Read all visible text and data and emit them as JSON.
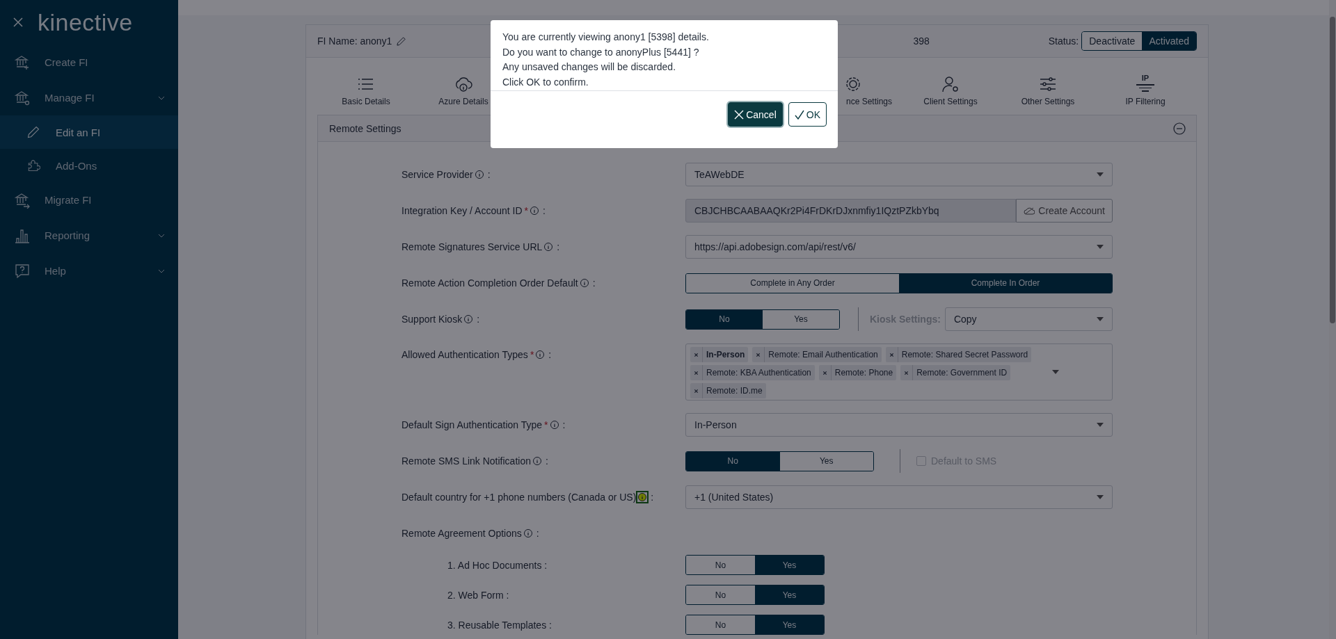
{
  "sidebar": {
    "logo": "kinective",
    "items": [
      {
        "label": "Create FI",
        "selected": false
      },
      {
        "label": "Manage FI",
        "selected": false,
        "chevron": true,
        "children": [
          {
            "label": "Edit an FI",
            "selected": true
          },
          {
            "label": "Add-Ons",
            "selected": false
          }
        ]
      },
      {
        "label": "Migrate FI",
        "selected": false
      },
      {
        "label": "Reporting",
        "selected": false,
        "chevron": true
      },
      {
        "label": "Help",
        "selected": false,
        "chevron": true
      }
    ]
  },
  "header": {
    "fi_name": "FI Name: anony1",
    "fi_id_tail": "398",
    "status_label": "Status:",
    "status_options": [
      {
        "label": "Deactivate",
        "selected": false
      },
      {
        "label": "Activated",
        "selected": true
      }
    ]
  },
  "tabs": [
    {
      "label": "Basic Details",
      "selected": false
    },
    {
      "label": "Azure Details",
      "selected": false
    },
    {
      "label": "nce Settings",
      "selected": false
    },
    {
      "label": "Client Settings",
      "selected": false
    },
    {
      "label": "Other Settings",
      "selected": false
    },
    {
      "label": "IP Filtering",
      "icon_text": "IP",
      "selected": false
    }
  ],
  "panel": {
    "title": "Remote Settings",
    "expanded": true,
    "rows": [
      {
        "kind": "select",
        "label": "Service Provider",
        "info": true,
        "colon": ":",
        "value": "TeAWebDE"
      },
      {
        "kind": "input_button",
        "label": "Integration Key / Account ID",
        "required": "*",
        "info": true,
        "colon": ":",
        "value": "CBJCHBCAABAAQKr2Pi4FrDKrDJxnmfiy1IQztPZkbYbq",
        "button": "Create Account"
      },
      {
        "kind": "select",
        "label": "Remote Signatures Service URL",
        "info": true,
        "colon": ":",
        "value": "https://api.adobesign.com/api/rest/v6/"
      },
      {
        "kind": "segmented",
        "label": "Remote Action Completion Order Default",
        "info": true,
        "colon": ":",
        "options": [
          {
            "label": "Complete in Any Order",
            "selected": false
          },
          {
            "label": "Complete In Order",
            "selected": true
          }
        ]
      },
      {
        "kind": "toggle_select",
        "label": "Support Kiosk",
        "info": true,
        "colon": ":",
        "options": [
          {
            "label": "No",
            "selected": true
          },
          {
            "label": "Yes",
            "selected": false
          }
        ],
        "side_label": "Kiosk Settings:",
        "side_disabled": true,
        "value": "Copy"
      },
      {
        "kind": "tags",
        "label": "Allowed Authentication Types",
        "required": "*",
        "info": true,
        "colon": ":",
        "tags": [
          {
            "label": "In-Person",
            "bold": true
          },
          {
            "label": "Remote: Email Authentication",
            "bold": false
          },
          {
            "label": "Remote: Shared Secret Password",
            "bold": false
          },
          {
            "label": "Remote: KBA Authentication",
            "bold": false
          },
          {
            "label": "Remote: Phone",
            "bold": false
          },
          {
            "label": "Remote: Government ID",
            "bold": false
          },
          {
            "label": "Remote: ID.me",
            "bold": false
          }
        ]
      },
      {
        "kind": "select",
        "label": "Default Sign Authentication Type",
        "required": "*",
        "info": true,
        "colon": ":",
        "value": "In-Person"
      },
      {
        "kind": "toggle_check",
        "label": "Remote SMS Link Notification",
        "info": true,
        "colon": ":",
        "options": [
          {
            "label": "No",
            "selected": true
          },
          {
            "label": "Yes",
            "selected": false
          }
        ],
        "check_label": "Default to SMS",
        "checked": false,
        "check_disabled": true
      },
      {
        "kind": "select",
        "label": "Default country for +1 phone numbers (Canada or US)",
        "info": true,
        "colon": ":",
        "info_highlighted": true,
        "value": "+1 (United States)"
      },
      {
        "kind": "heading",
        "label": "Remote Agreement Options",
        "info": true,
        "colon": ":"
      },
      {
        "kind": "sub_toggle",
        "label": "1. Ad Hoc Documents :",
        "options": [
          {
            "label": "No",
            "selected": false
          },
          {
            "label": "Yes",
            "selected": true
          }
        ]
      },
      {
        "kind": "sub_toggle",
        "label": "2. Web Form :",
        "options": [
          {
            "label": "No",
            "selected": false
          },
          {
            "label": "Yes",
            "selected": true
          }
        ]
      },
      {
        "kind": "sub_toggle",
        "label": "3. Reusable Templates :",
        "options": [
          {
            "label": "No",
            "selected": false
          },
          {
            "label": "Yes",
            "selected": true
          }
        ]
      }
    ]
  },
  "dialog": {
    "lines": [
      "You are currently viewing anony1 [5398] details.",
      "Do you want to change to anonyPlus [5441] ?",
      "Any unsaved changes will be discarded.",
      "Click OK to confirm."
    ],
    "buttons": [
      {
        "label": "Cancel",
        "primary": true
      },
      {
        "label": "OK",
        "primary": false
      }
    ]
  }
}
